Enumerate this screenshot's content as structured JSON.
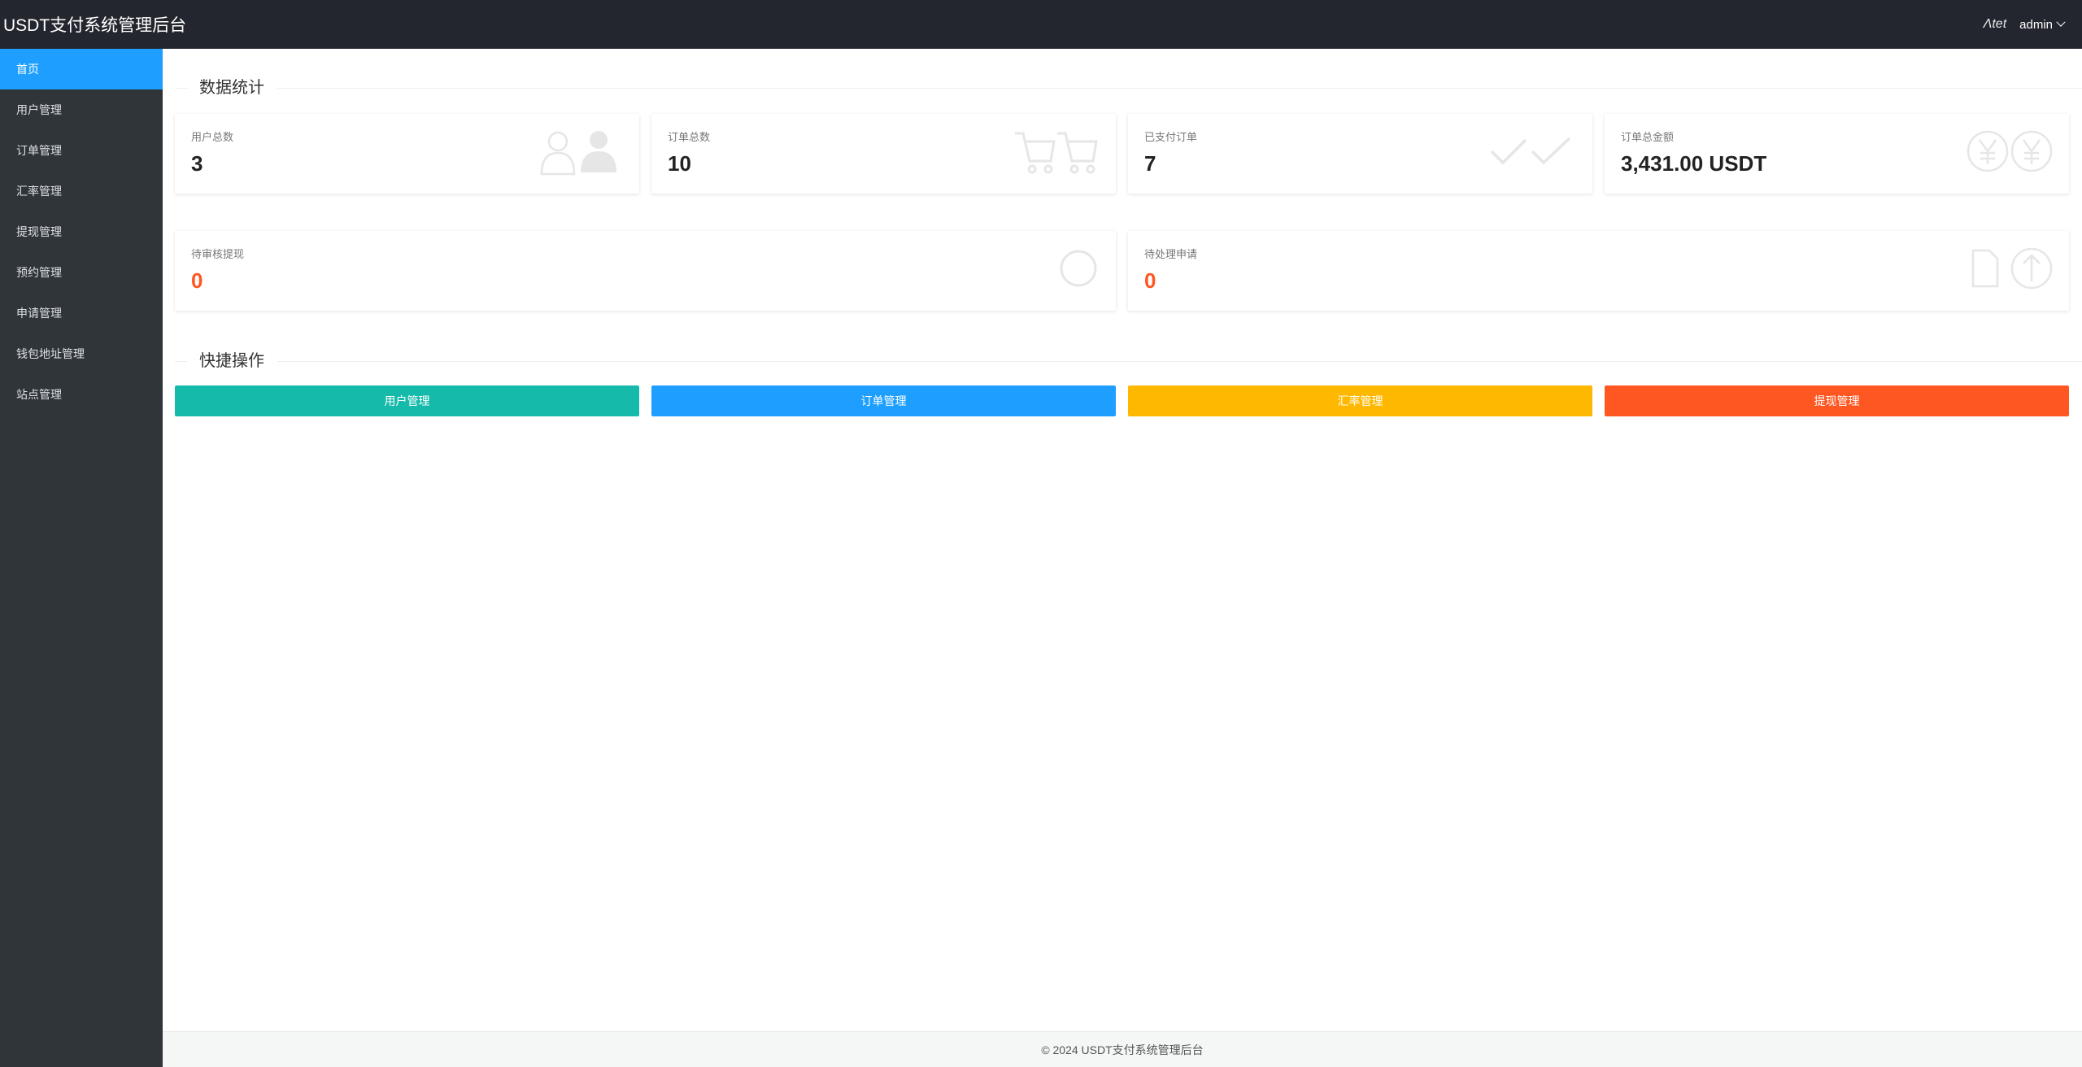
{
  "header": {
    "title": "USDT支付系统管理后台",
    "icon_text": "Λtet",
    "user": "admin"
  },
  "sidebar": {
    "items": [
      {
        "label": "首页"
      },
      {
        "label": "用户管理"
      },
      {
        "label": "订单管理"
      },
      {
        "label": "汇率管理"
      },
      {
        "label": "提现管理"
      },
      {
        "label": "预约管理"
      },
      {
        "label": "申请管理"
      },
      {
        "label": "钱包地址管理"
      },
      {
        "label": "站点管理"
      }
    ],
    "active_index": 0
  },
  "stats": {
    "title": "数据统计",
    "cards": [
      {
        "label": "用户总数",
        "value": "3",
        "icon": "users-icon"
      },
      {
        "label": "订单总数",
        "value": "10",
        "icon": "cart-icon"
      },
      {
        "label": "已支付订单",
        "value": "7",
        "icon": "check-icon"
      },
      {
        "label": "订单总金额",
        "value": "3,431.00 USDT",
        "icon": "yen-icon"
      },
      {
        "label": "待审核提现",
        "value": "0",
        "icon": "circle-icon"
      },
      {
        "label": "待处理申请",
        "value": "0",
        "icon": "upload-icon"
      }
    ]
  },
  "quick": {
    "title": "快捷操作",
    "buttons": [
      {
        "label": "用户管理",
        "color": "#16baaa"
      },
      {
        "label": "订单管理",
        "color": "#1e9fff"
      },
      {
        "label": "汇率管理",
        "color": "#ffb800"
      },
      {
        "label": "提现管理",
        "color": "#ff5722"
      }
    ]
  },
  "footer": {
    "text": "© 2024 USDT支付系统管理后台"
  },
  "colors": {
    "header_bg": "#23262e",
    "sidebar_bg": "#2f3539",
    "active": "#1e9fff",
    "accent_red": "#ff5722"
  }
}
